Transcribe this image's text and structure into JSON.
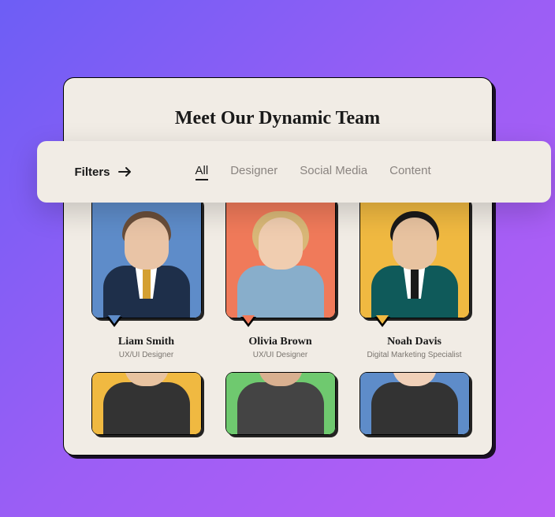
{
  "header": {
    "title": "Meet Our Dynamic Team"
  },
  "filters": {
    "label": "Filters",
    "tabs": [
      {
        "label": "All",
        "active": true
      },
      {
        "label": "Designer",
        "active": false
      },
      {
        "label": "Social Media",
        "active": false
      },
      {
        "label": "Content",
        "active": false
      }
    ]
  },
  "team": [
    {
      "name": "Liam Smith",
      "role": "UX/UI Designer",
      "bg": "#5e8cc9",
      "skin": "#e9c4a6",
      "hair": "#6a4e3a",
      "suit": "#1e2f4a",
      "tie": "#d4a031"
    },
    {
      "name": "Olivia Brown",
      "role": "UX/UI Designer",
      "bg": "#f07a5a",
      "skin": "#f0cdb0",
      "hair": "#d9b878",
      "suit": "#88aecb",
      "tie": "transparent"
    },
    {
      "name": "Noah Davis",
      "role": "Digital Marketing Specialist",
      "bg": "#f0b941",
      "skin": "#e8c3a0",
      "hair": "#1a1a1a",
      "suit": "#0f5a5a",
      "tie": "#1a1a1a"
    },
    {
      "name": "",
      "role": "",
      "bg": "#f0b941",
      "skin": "#e8c3a0",
      "hair": "#1a1a1a",
      "suit": "#333",
      "tie": "transparent"
    },
    {
      "name": "",
      "role": "",
      "bg": "#6fc96f",
      "skin": "#d9b090",
      "hair": "#3a2a1f",
      "suit": "#444",
      "tie": "transparent"
    },
    {
      "name": "",
      "role": "",
      "bg": "#5e8cc9",
      "skin": "#f0d0b8",
      "hair": "#b0281e",
      "suit": "#333",
      "tie": "transparent"
    }
  ]
}
